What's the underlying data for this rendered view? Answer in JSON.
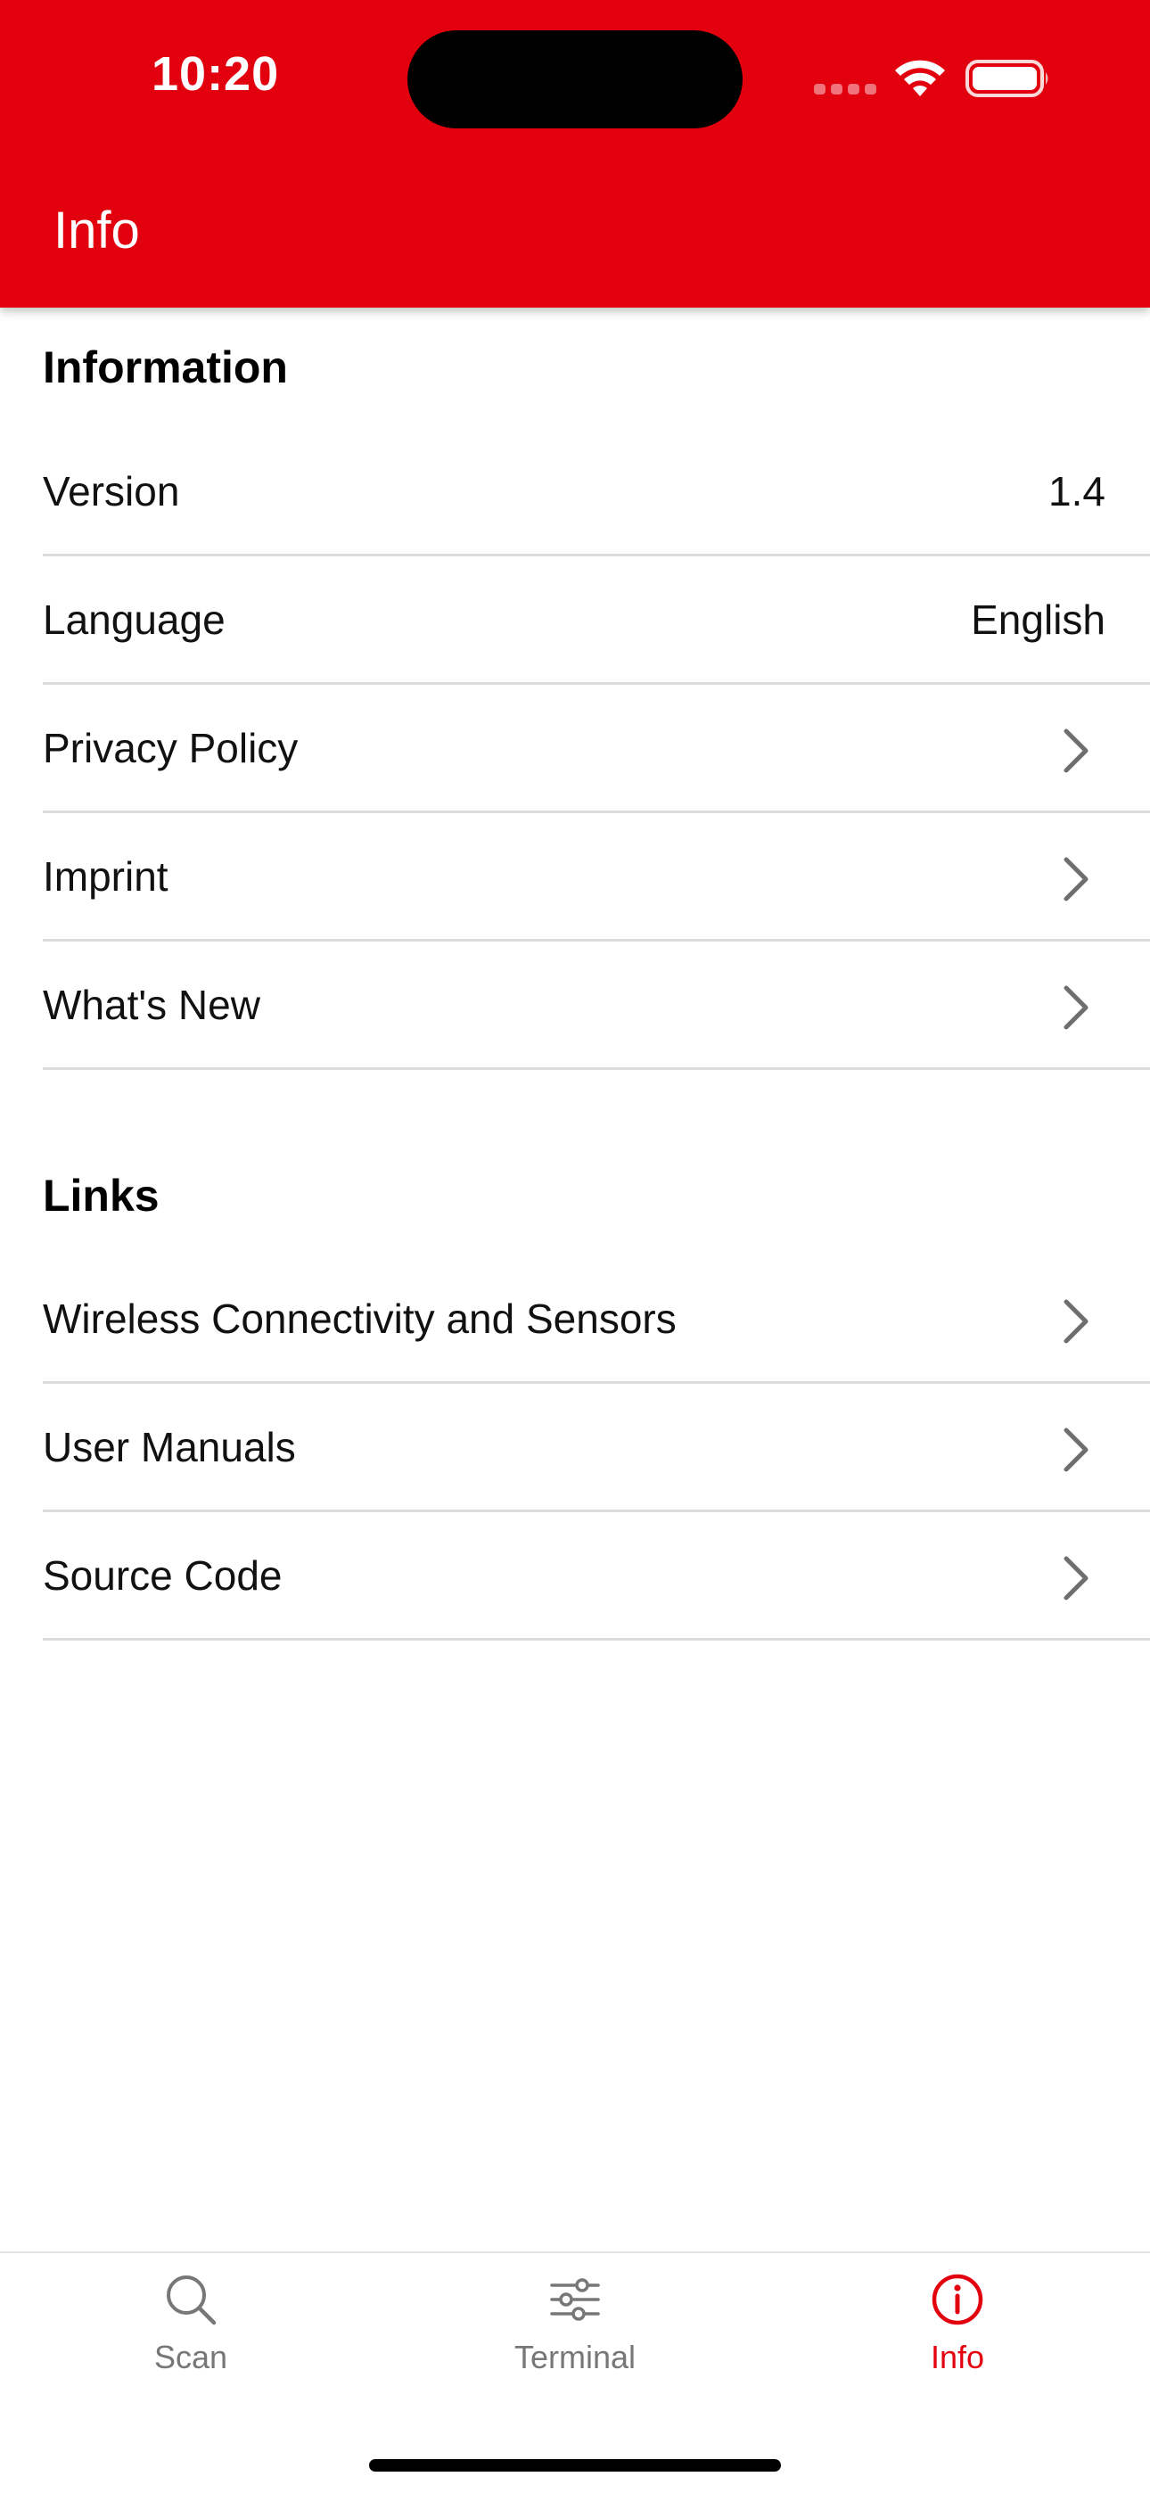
{
  "status_bar": {
    "time": "10:20"
  },
  "header": {
    "title": "Info",
    "background_color": "#e2000f"
  },
  "sections": [
    {
      "title": "Information",
      "rows": [
        {
          "label": "Version",
          "value": "1.4",
          "icon": "none"
        },
        {
          "label": "Language",
          "value": "English",
          "icon": "none"
        },
        {
          "label": "Privacy Policy",
          "value": "",
          "icon": "chevron-right-icon"
        },
        {
          "label": "Imprint",
          "value": "",
          "icon": "chevron-right-icon"
        },
        {
          "label": "What's New",
          "value": "",
          "icon": "chevron-right-icon"
        }
      ]
    },
    {
      "title": "Links",
      "rows": [
        {
          "label": "Wireless Connectivity and Sensors",
          "value": "",
          "icon": "chevron-right-icon"
        },
        {
          "label": "User Manuals",
          "value": "",
          "icon": "chevron-right-icon"
        },
        {
          "label": "Source Code",
          "value": "",
          "icon": "chevron-right-icon"
        }
      ]
    }
  ],
  "tabbar": {
    "tabs": [
      {
        "label": "Scan",
        "icon": "search-icon",
        "active": false
      },
      {
        "label": "Terminal",
        "icon": "sliders-icon",
        "active": false
      },
      {
        "label": "Info",
        "icon": "info-icon",
        "active": true
      }
    ],
    "active_color": "#e2000f",
    "inactive_color": "#777777"
  }
}
